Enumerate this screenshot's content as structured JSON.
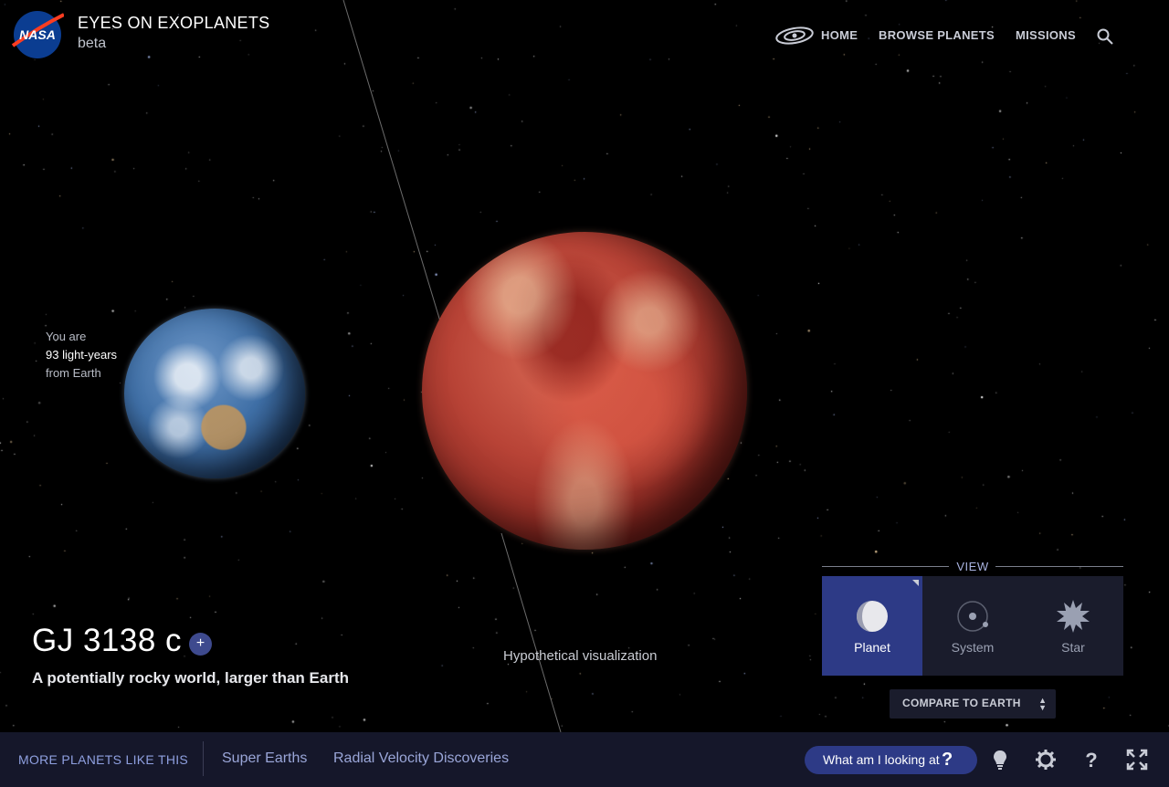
{
  "header": {
    "logo_text": "NASA",
    "title": "EYES ON EXOPLANETS",
    "subtitle": "beta",
    "nav": {
      "home": "HOME",
      "browse": "BROWSE PLANETS",
      "missions": "MISSIONS"
    },
    "icons": [
      "galaxy-icon",
      "search-icon"
    ]
  },
  "scene": {
    "distance_prefix": "You are",
    "distance_value": "93 light-years",
    "distance_suffix": "from Earth",
    "hypothetical": "Hypothetical visualization"
  },
  "planet": {
    "name": "GJ 3138 c",
    "add_label": "+",
    "description": "A potentially rocky world, larger than Earth"
  },
  "view": {
    "label": "VIEW",
    "options": [
      "Planet",
      "System",
      "Star"
    ],
    "selected": "Planet",
    "compare_label": "COMPARE TO EARTH"
  },
  "footer": {
    "more_label": "MORE PLANETS LIKE THIS",
    "links": [
      "Super Earths",
      "Radial Velocity Discoveries"
    ],
    "what_am_i": "What am I looking at",
    "what_am_i_icon": "?",
    "icons": [
      "lightbulb-icon",
      "settings-icon",
      "help-icon",
      "fullscreen-icon"
    ]
  },
  "colors": {
    "accent": "#2d3a86",
    "footer_bg": "#15172a",
    "link": "#9aa6d8"
  }
}
